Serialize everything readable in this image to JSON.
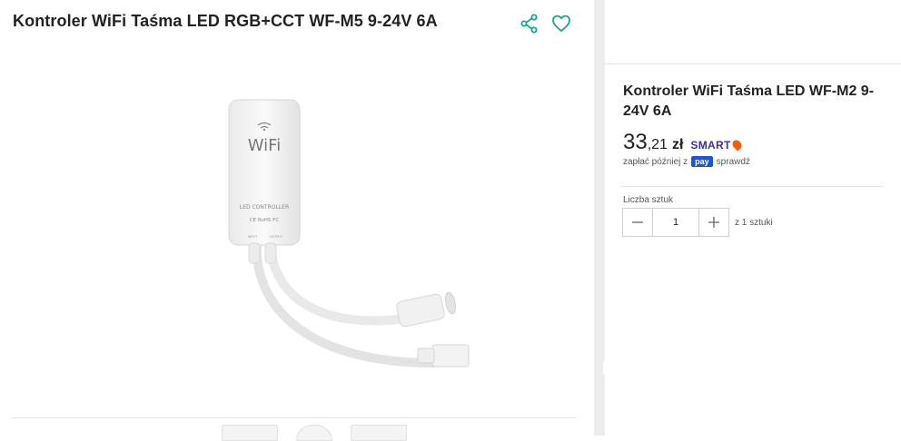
{
  "product": {
    "title": "Kontroler WiFi Taśma LED RGB+CCT WF-M5 9-24V 6A",
    "image_labels": {
      "wifi": "WiFi",
      "controller": "LED CONTROLLER",
      "certs": "CE RoHS FC",
      "input": "INPUT",
      "output": "OUTPUT"
    }
  },
  "icons": {
    "share": "share-icon",
    "favorite": "heart-icon"
  },
  "offer": {
    "title": "Kontroler WiFi Taśma LED WF-M2 9-24V 6A",
    "price_int": "33",
    "price_dec": ",21",
    "currency": "zł",
    "smart": "SMART",
    "pay_prefix": "zapłać później z",
    "pay_badge": "pay",
    "pay_suffix": "sprawdź",
    "qty_label": "Liczba sztuk",
    "qty_value": "1",
    "qty_of": "z 1 sztuki"
  },
  "colors": {
    "smart": "#3b2fa5",
    "smart_pin": "#ff5a00",
    "pay_badge": "#1a57d6",
    "share": "#17a589",
    "heart": "#17a589"
  }
}
